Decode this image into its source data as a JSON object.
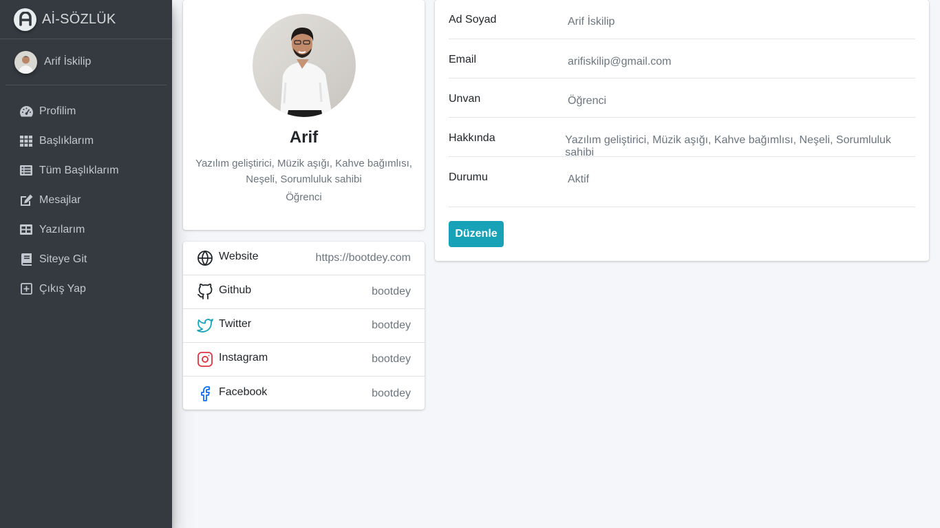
{
  "brand": {
    "name": "Aİ-SÖZLÜK"
  },
  "sidebar": {
    "user_name": "Arif İskilip",
    "items": [
      {
        "label": "Profilim",
        "icon": "dashboard-icon"
      },
      {
        "label": "Başlıklarım",
        "icon": "grid-icon"
      },
      {
        "label": "Tüm Başlıklarım",
        "icon": "list-icon"
      },
      {
        "label": "Mesajlar",
        "icon": "edit-icon"
      },
      {
        "label": "Yazılarım",
        "icon": "table-icon"
      },
      {
        "label": "Siteye Git",
        "icon": "book-icon"
      },
      {
        "label": "Çıkış Yap",
        "icon": "plus-square-icon"
      }
    ]
  },
  "profile": {
    "name": "Arif",
    "about": "Yazılım geliştirici, Müzik aşığı, Kahve bağımlısı, Neşeli, Sorumluluk sahibi",
    "role": "Öğrenci"
  },
  "social": [
    {
      "label": "Website",
      "value": "https://bootdey.com",
      "icon": "globe-icon"
    },
    {
      "label": "Github",
      "value": "bootdey",
      "icon": "github-icon"
    },
    {
      "label": "Twitter",
      "value": "bootdey",
      "icon": "twitter-icon"
    },
    {
      "label": "Instagram",
      "value": "bootdey",
      "icon": "instagram-icon"
    },
    {
      "label": "Facebook",
      "value": "bootdey",
      "icon": "facebook-icon"
    }
  ],
  "details": [
    {
      "key": "Ad Soyad",
      "value": "Arif İskilip"
    },
    {
      "key": "Email",
      "value": "arifiskilip@gmail.com"
    },
    {
      "key": "Unvan",
      "value": "Öğrenci"
    },
    {
      "key": "Hakkında",
      "value": "Yazılım geliştirici, Müzik aşığı, Kahve bağımlısı, Neşeli, Sorumluluk sahibi"
    },
    {
      "key": "Durumu",
      "value": "Aktif"
    }
  ],
  "edit_button": {
    "label": "Düzenle"
  },
  "colors": {
    "sidebar_bg": "#343a40",
    "sidebar_text": "#c2c7d0",
    "page_bg": "#f4f6f9",
    "accent_button": "#17a2b8",
    "twitter": "#1da1f2",
    "instagram": "#dc3545",
    "facebook": "#0d6efd"
  }
}
